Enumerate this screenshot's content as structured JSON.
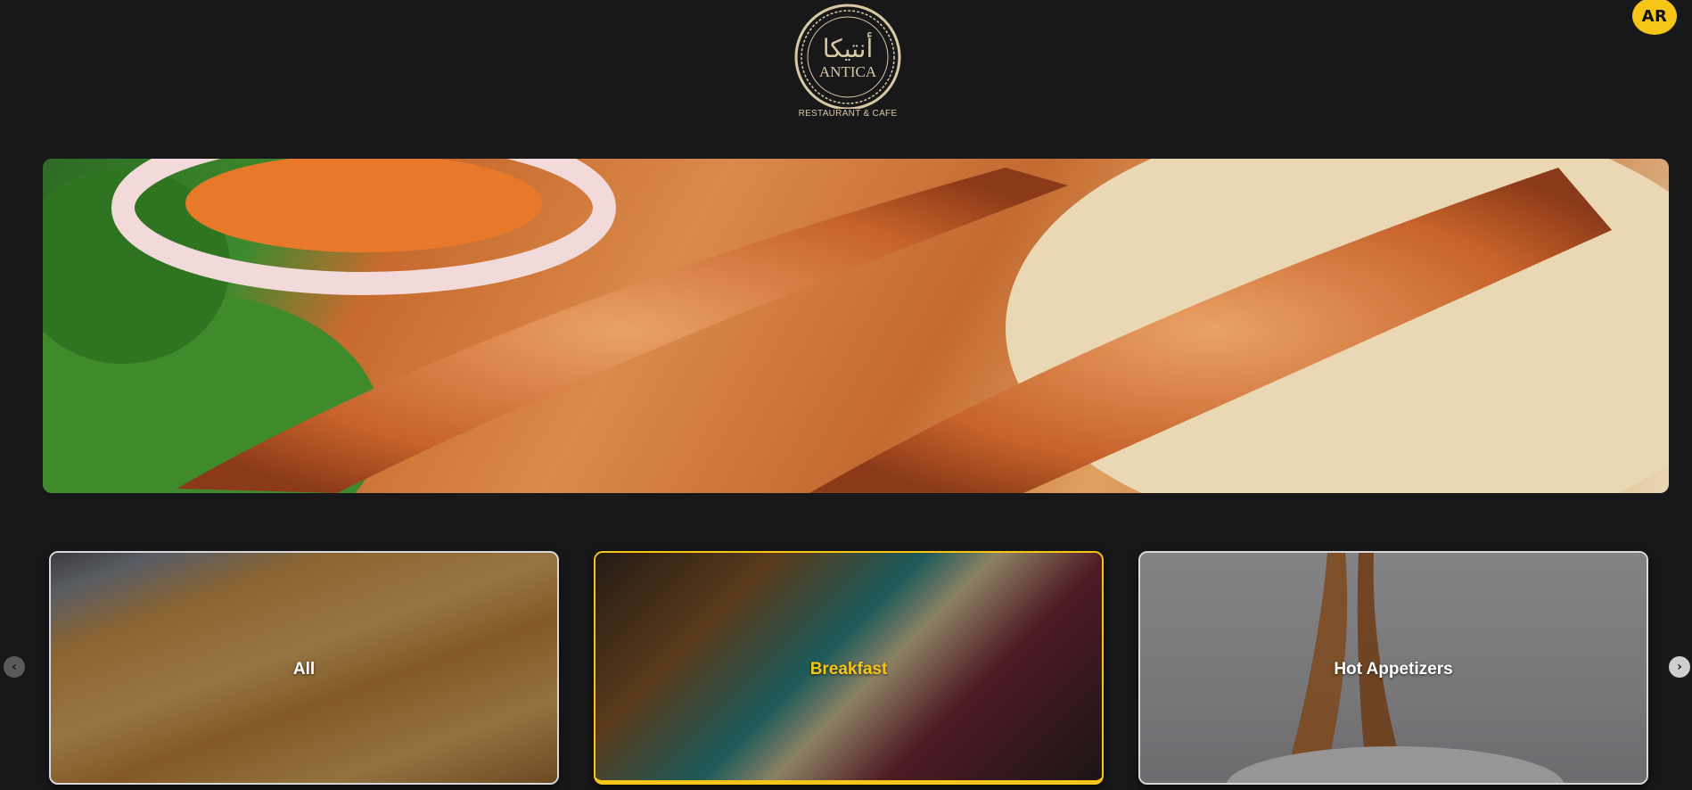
{
  "header": {
    "language_toggle": "AR",
    "logo": {
      "arabic_text": "أنتيكا",
      "latin_text": "ANTICA",
      "subtitle": "RESTAURANT & CAFE"
    }
  },
  "hero": {
    "image": "grilled-kebab-skewers-on-flatbread-with-onion-salad",
    "description_icon": "kebab-photo"
  },
  "categories": {
    "prev_icon": "chevron-left-icon",
    "next_icon": "chevron-right-icon",
    "active": "Breakfast",
    "items": [
      {
        "label": "All",
        "image": "pastry-photo"
      },
      {
        "label": "Breakfast",
        "image": "breakfast-spread-photo"
      },
      {
        "label": "Hot Appetizers",
        "image": "spaghetti-photo"
      }
    ]
  },
  "colors": {
    "background": "#18181b",
    "accent": "#f5c518",
    "logo_gold": "#d9c9a3"
  }
}
